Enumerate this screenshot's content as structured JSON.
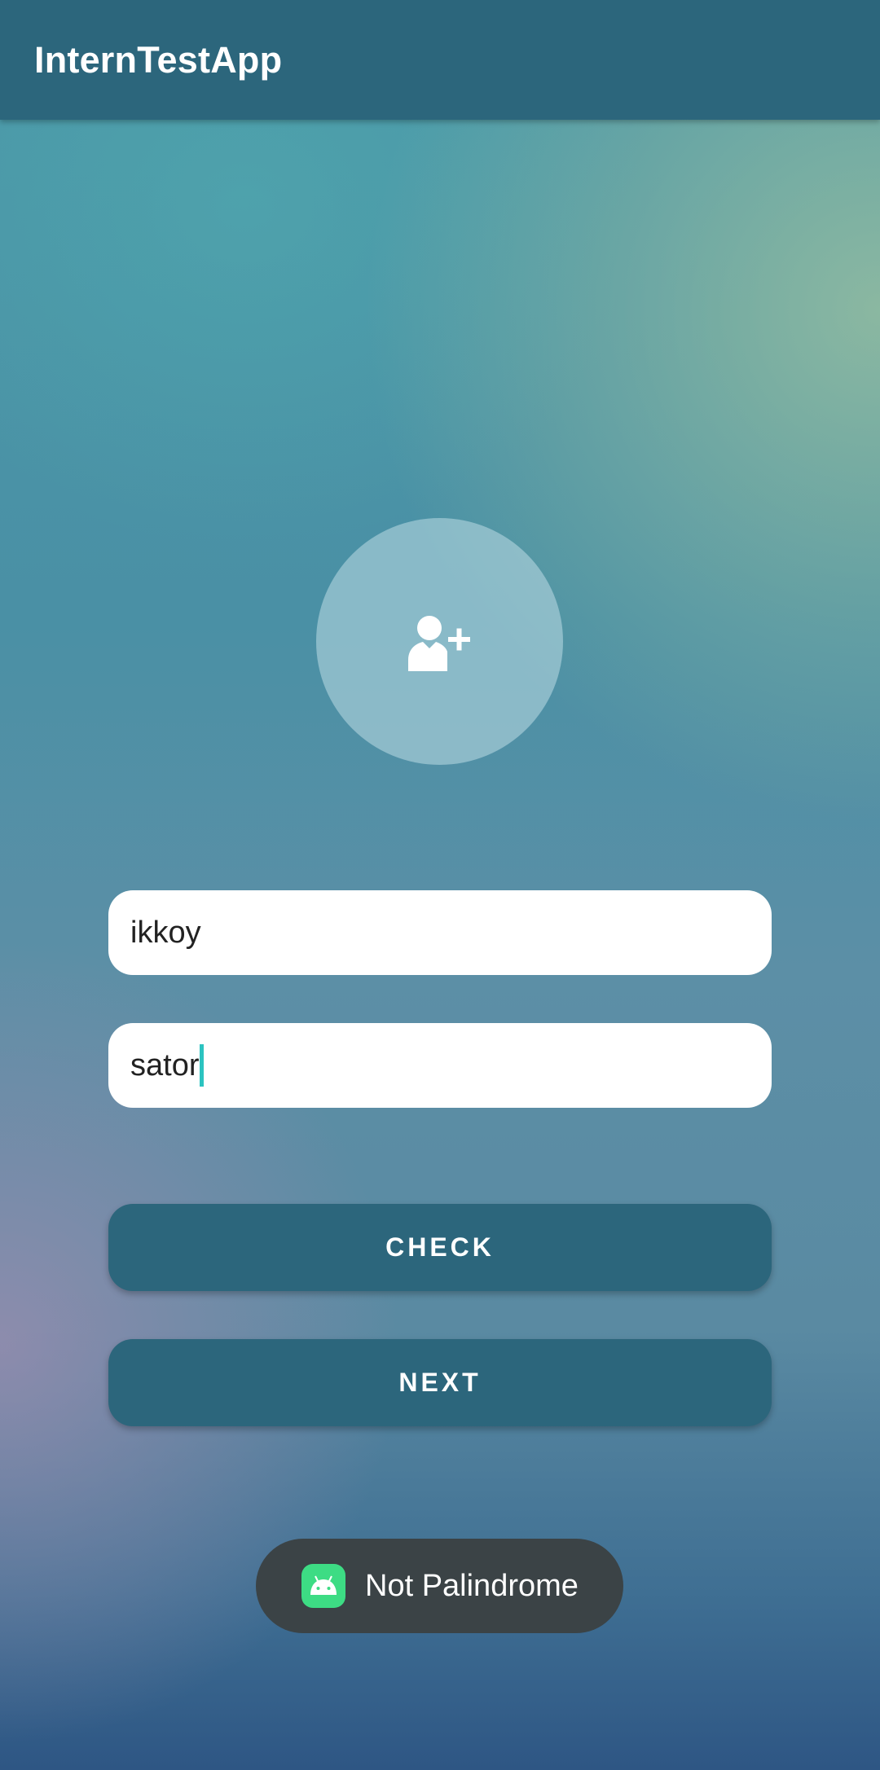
{
  "app_bar": {
    "title": "InternTestApp"
  },
  "avatar": {
    "icon": "add-user-icon"
  },
  "form": {
    "name_value": "ikkoy",
    "palindrome_value": "sator"
  },
  "buttons": {
    "check_label": "CHECK",
    "next_label": "NEXT"
  },
  "toast": {
    "icon": "android-icon",
    "message": "Not Palindrome"
  },
  "colors": {
    "primary": "#2c667c",
    "caret": "#2cc3c0",
    "toast_bg": "#3b4346",
    "android_green": "#3ddc84"
  }
}
